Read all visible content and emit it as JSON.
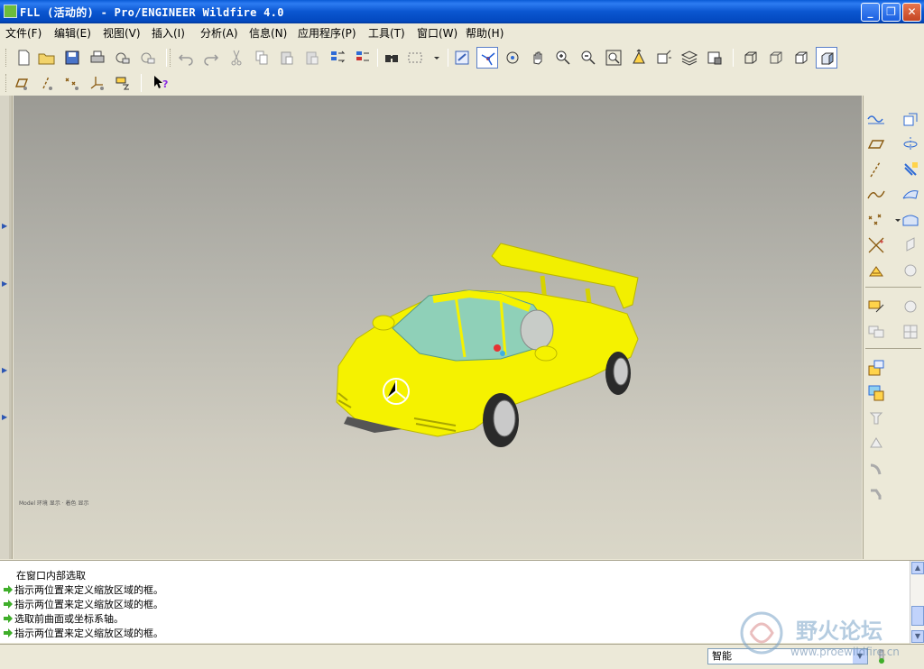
{
  "window": {
    "title": "FLL (活动的) - Pro/ENGINEER Wildfire 4.0",
    "minimize_label": "_",
    "maximize_label": "❐",
    "close_label": "✕"
  },
  "menu": [
    "文件(F)",
    "编辑(E)",
    "视图(V)",
    "插入(I)",
    "分析(A)",
    "信息(N)",
    "应用程序(P)",
    "工具(T)",
    "窗口(W)",
    "帮助(H)"
  ],
  "toolbar": {
    "icons": [
      "new-icon",
      "open-icon",
      "save-icon",
      "print-icon",
      "send-mail-icon",
      "send-link-icon",
      "undo-icon",
      "redo-icon",
      "cut-icon",
      "copy-icon",
      "paste-icon",
      "paste-special-icon",
      "regenerate-icon",
      "regen-manager-icon",
      "find-icon",
      "selection-box-icon",
      "repaint-icon",
      "spin-center-icon",
      "orient-mode-icon",
      "pan-icon",
      "zoom-in-icon",
      "zoom-out-icon",
      "refit-icon",
      "reorient-icon",
      "saved-views-icon",
      "layers-icon",
      "view-manager-icon",
      "wireframe-icon",
      "hidden-line-icon",
      "no-hidden-icon",
      "shading-icon"
    ],
    "datum_icons": [
      "datum-plane-display-icon",
      "datum-axis-display-icon",
      "datum-point-display-icon",
      "coordinate-system-display-icon",
      "annotation-display-icon",
      "context-help-icon"
    ]
  },
  "viewport": {
    "model_note": "Model 环境 显示 · 着色 显示"
  },
  "right_toolbar": {
    "icons": [
      "sketch-tool-icon",
      "datum-plane-icon",
      "datum-axis-icon",
      "datum-curve-icon",
      "datum-point-icon",
      "datum-csys-icon",
      "analysis-feature-icon",
      "extrude-icon",
      "revolve-icon",
      "variable-section-sweep-icon",
      "boundary-blend-icon",
      "style-icon",
      "edit-copy-icon",
      "mirror-icon",
      "merge-icon",
      "trim-icon",
      "intersect-icon",
      "pattern-icon",
      "fill-icon",
      "offset-icon",
      "thicken-icon",
      "solidify-icon",
      "round-icon",
      "chamfer-icon",
      "draft-icon"
    ]
  },
  "messages": {
    "lines": [
      {
        "text": "在窗口内部选取",
        "arrow": false
      },
      {
        "text": "指示两位置来定义缩放区域的框。",
        "arrow": true
      },
      {
        "text": "指示两位置来定义缩放区域的框。",
        "arrow": true
      },
      {
        "text": "选取前曲面或坐标系轴。",
        "arrow": true
      },
      {
        "text": "指示两位置来定义缩放区域的框。",
        "arrow": true
      }
    ]
  },
  "status": {
    "filter_value": "智能"
  },
  "watermark": {
    "text": "野火论坛",
    "url": "www.proewildfire.cn"
  },
  "colors": {
    "title_bar": "#0a56d0",
    "car_body": "#f5f200",
    "glass": "#8fd0b8",
    "message_arrow": "#3fae2a"
  }
}
